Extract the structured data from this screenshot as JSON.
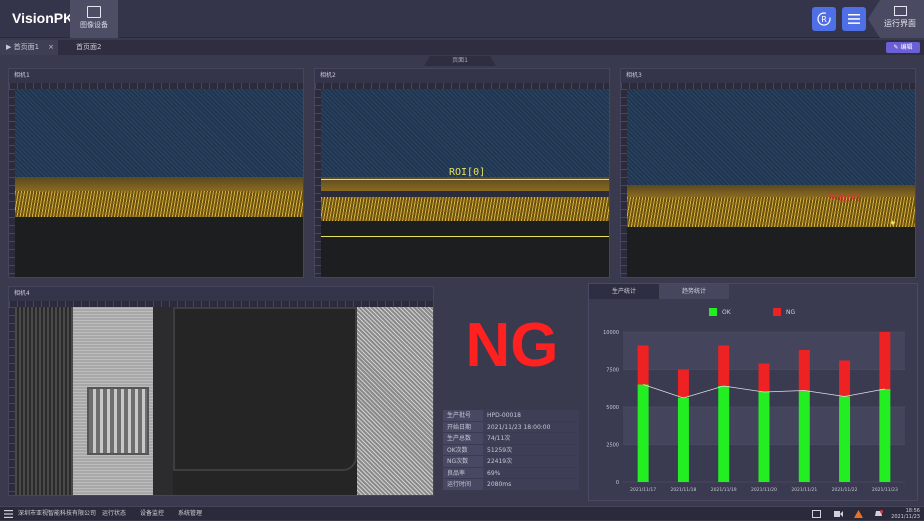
{
  "app": {
    "name": "VisionPK"
  },
  "toolbar": {
    "image_button_label": "图像设备",
    "refresh_label": "R",
    "run_view_label": "运行界面"
  },
  "tabs": [
    {
      "label": "首页面1",
      "active": true
    },
    {
      "label": "首页面2",
      "active": false
    }
  ],
  "edit_button": "✎ 编辑",
  "page_marker": "页面1",
  "cameras": [
    {
      "title": "相机1"
    },
    {
      "title": "相机2",
      "roi_label": "ROI[0]"
    },
    {
      "title": "相机3",
      "defect_label": "NG框[0]"
    },
    {
      "title": "相机4"
    }
  ],
  "result": {
    "text": "NG",
    "color": "#ff2020"
  },
  "info": [
    {
      "key": "生产批号",
      "value": "HPD-00018"
    },
    {
      "key": "开始日期",
      "value": "2021/11/23 18:00:00"
    },
    {
      "key": "生产总数",
      "value": "74/11次"
    },
    {
      "key": "OK次数",
      "value": "51259次"
    },
    {
      "key": "NG次数",
      "value": "22419次"
    },
    {
      "key": "良品率",
      "value": "69%"
    },
    {
      "key": "运行时间",
      "value": "2080ms"
    }
  ],
  "chart_tabs": [
    {
      "label": "生产统计",
      "active": true
    },
    {
      "label": "趋势统计",
      "active": false
    }
  ],
  "chart_data": {
    "type": "bar",
    "stacked": true,
    "categories": [
      "2021/11/17",
      "2021/11/18",
      "2021/11/19",
      "2021/11/20",
      "2021/11/21",
      "2021/11/22",
      "2021/11/23"
    ],
    "series": [
      {
        "name": "OK",
        "color": "#22ee22",
        "values": [
          6500,
          5600,
          6400,
          6000,
          6100,
          5700,
          6200
        ]
      },
      {
        "name": "NG",
        "color": "#ee2222",
        "values": [
          2600,
          1900,
          2700,
          1900,
          2700,
          2400,
          3800
        ]
      }
    ],
    "y_ticks": [
      "0",
      "2500",
      "5000",
      "7500",
      "10000"
    ],
    "ylim": [
      0,
      10000
    ],
    "legend": "top",
    "title": "",
    "xlabel": "",
    "ylabel": ""
  },
  "statusbar": {
    "items": [
      "深圳市亚视智能科技有限公司",
      "运行状态",
      "设备监控",
      "系统管理"
    ],
    "time": "18:56",
    "date": "2021/11/23"
  }
}
